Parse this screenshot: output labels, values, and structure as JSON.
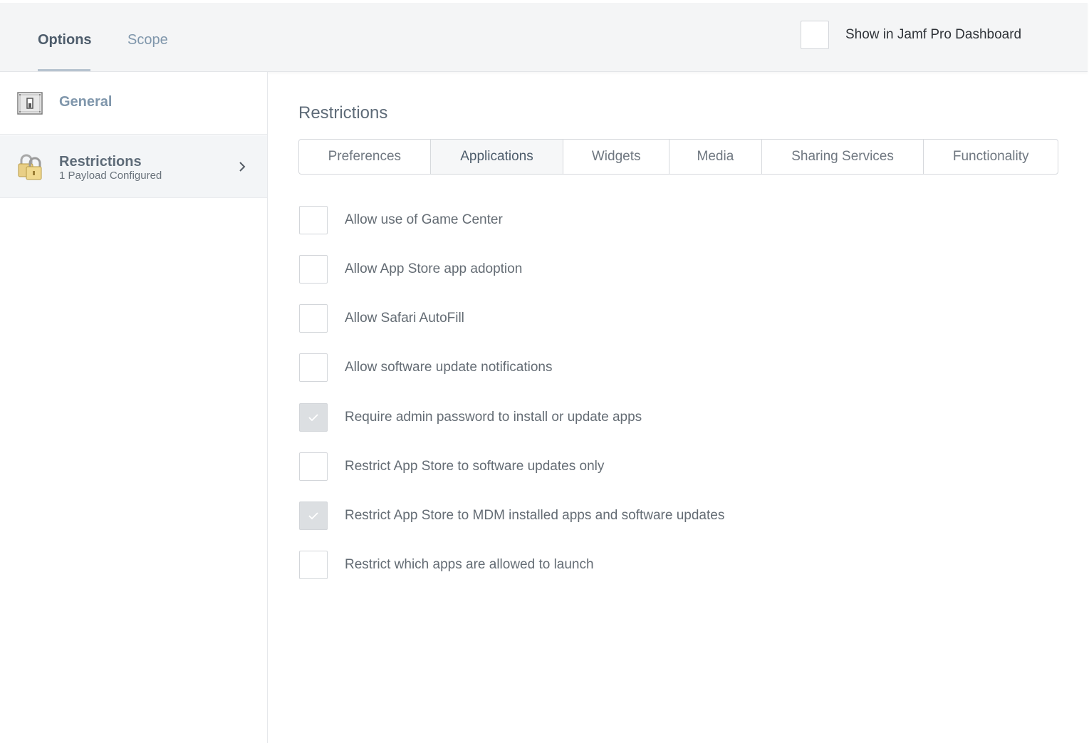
{
  "header": {
    "tabs": [
      {
        "label": "Options",
        "active": true
      },
      {
        "label": "Scope",
        "active": false
      }
    ],
    "dashboard_toggle": {
      "label": "Show in Jamf Pro Dashboard",
      "checked": false
    }
  },
  "sidebar": {
    "items": [
      {
        "title": "General",
        "icon": "switch-icon"
      },
      {
        "title": "Restrictions",
        "subtitle": "1 Payload Configured",
        "icon": "padlock-icon",
        "selected": true
      }
    ]
  },
  "main": {
    "section_title": "Restrictions",
    "subtabs": [
      {
        "label": "Preferences"
      },
      {
        "label": "Applications",
        "active": true
      },
      {
        "label": "Widgets"
      },
      {
        "label": "Media"
      },
      {
        "label": "Sharing Services"
      },
      {
        "label": "Functionality"
      }
    ],
    "options": [
      {
        "label": "Allow use of Game Center",
        "checked": false
      },
      {
        "label": "Allow App Store app adoption",
        "checked": false
      },
      {
        "label": "Allow Safari AutoFill",
        "checked": false
      },
      {
        "label": "Allow software update notifications",
        "checked": false
      },
      {
        "label": "Require admin password to install or update apps",
        "checked": true
      },
      {
        "label": "Restrict App Store to software updates only",
        "checked": false
      },
      {
        "label": "Restrict App Store to MDM installed apps and software updates",
        "checked": true
      },
      {
        "label": "Restrict which apps are allowed to launch",
        "checked": false
      }
    ]
  },
  "colors": {
    "accent": "#7f96ab",
    "header_bg": "#f4f5f6",
    "checked_box": "#dcdfe2"
  }
}
